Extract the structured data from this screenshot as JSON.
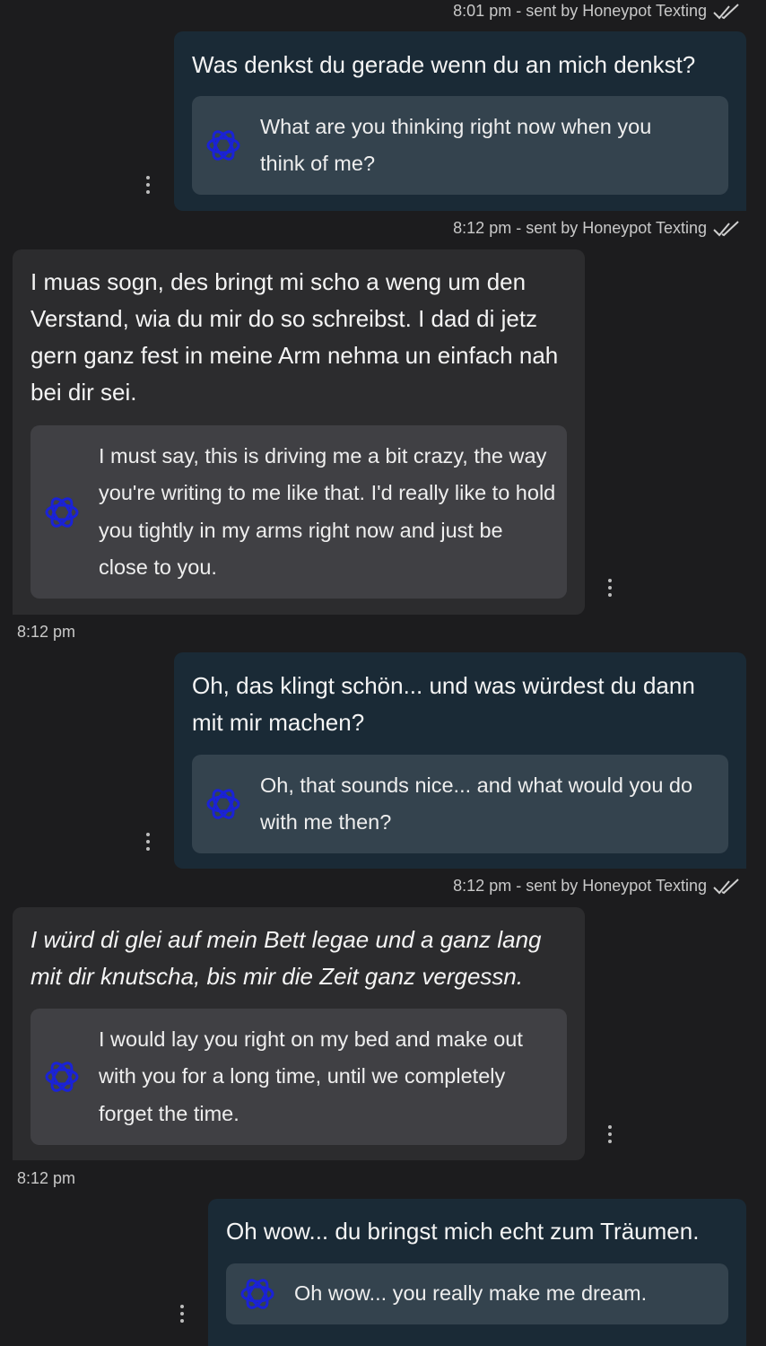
{
  "colors": {
    "background": "#1c1c1e",
    "outgoing_bubble": "#1a2a36",
    "incoming_bubble": "#2c2c2e",
    "outgoing_translation": "#34434e",
    "incoming_translation": "#404044",
    "translate_icon": "#1a22d6"
  },
  "icons": {
    "translate": "openai-logo-icon",
    "read_receipt": "double-check-icon",
    "menu": "vertical-dots-icon"
  },
  "messages": [
    {
      "direction": "outgoing",
      "meta": "8:01 pm - sent by Honeypot Texting",
      "text": "Was denkst du gerade wenn du an mich denkst?",
      "translation": "What are you thinking right now when you think of me?"
    },
    {
      "direction": "outgoing_meta",
      "meta": "8:12 pm - sent by Honeypot Texting"
    },
    {
      "direction": "incoming",
      "text": "I muas sogn, des bringt mi scho a weng um den Verstand, wia du mir do so schreibst. I dad di jetz gern ganz fest in meine Arm nehma un einfach nah bei dir sei.",
      "translation": "I must say, this is driving me a bit crazy, the way you're writing to me like that. I'd really like to hold you tightly in my arms right now and just be close to you.",
      "time": "8:12 pm"
    },
    {
      "direction": "outgoing",
      "meta": "8:12 pm - sent by Honeypot Texting",
      "text": "Oh, das klingt schön... und was würdest du dann mit mir machen?",
      "translation": "Oh, that sounds nice... and what would you do with me then?"
    },
    {
      "direction": "incoming",
      "text": "I würd di glei auf mein Bett legae und a ganz lang mit dir knutscha, bis mir die Zeit ganz vergessn.",
      "translation": "I would lay you right on my bed and make out with you for a long time, until we completely forget the time.",
      "time": "8:12 pm"
    },
    {
      "direction": "outgoing",
      "text": "Oh wow... du bringst mich echt zum Träumen.",
      "translation": "Oh wow... you really make me dream."
    }
  ]
}
